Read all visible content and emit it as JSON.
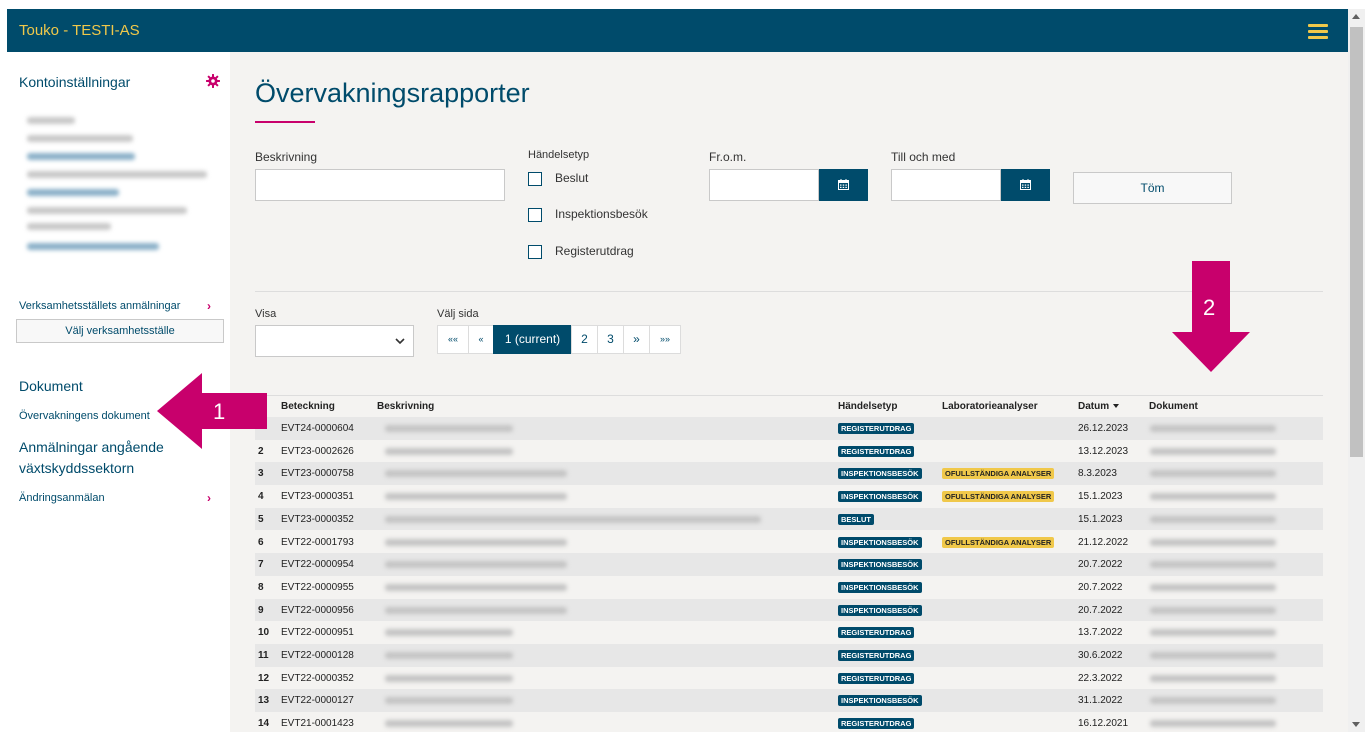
{
  "app": {
    "title": "Touko - TESTI-AS"
  },
  "colors": {
    "primary": "#004b6b",
    "accent": "#c8006c",
    "warning": "#f0c84a"
  },
  "sidebar": {
    "account_heading": "Kontoinställningar",
    "notifications_link": "Verksamhetsställets anmälningar",
    "select_site_button": "Välj verksamhetsställe",
    "documents_heading": "Dokument",
    "surveillance_docs_link": "Övervakningens dokument",
    "notifications_heading_line1": "Anmälningar angående",
    "notifications_heading_line2": "växtskyddssektorn",
    "change_notice_link": "Ändringsanmälan"
  },
  "main": {
    "title": "Övervakningsrapporter",
    "filters": {
      "description_label": "Beskrivning",
      "event_type_label": "Händelsetyp",
      "from_label": "Fr.o.m.",
      "to_label": "Till och med",
      "clear_button": "Töm",
      "checkboxes": [
        "Beslut",
        "Inspektionsbesök",
        "Registerutdrag"
      ]
    },
    "show_label": "Visa",
    "page_label": "Välj sida",
    "pagination": {
      "first": "««",
      "prev": "«",
      "current": "1 (current)",
      "page2": "2",
      "page3": "3",
      "next": "»",
      "last": "»»"
    },
    "table": {
      "headers": [
        "Beteckning",
        "Beskrivning",
        "Händelsetyp",
        "Laboratorieanalyser",
        "Datum",
        "Dokument"
      ],
      "rows": [
        {
          "num": "",
          "id": "EVT24-0000604",
          "type": "REGISTERUTDRAG",
          "lab": "",
          "date": "26.12.2023"
        },
        {
          "num": "2",
          "id": "EVT23-0002626",
          "type": "REGISTERUTDRAG",
          "lab": "",
          "date": "13.12.2023"
        },
        {
          "num": "3",
          "id": "EVT23-0000758",
          "type": "INSPEKTIONSBESÖK",
          "lab": "OFULLSTÄNDIGA ANALYSER",
          "date": "8.3.2023"
        },
        {
          "num": "4",
          "id": "EVT23-0000351",
          "type": "INSPEKTIONSBESÖK",
          "lab": "OFULLSTÄNDIGA ANALYSER",
          "date": "15.1.2023"
        },
        {
          "num": "5",
          "id": "EVT23-0000352",
          "type": "BESLUT",
          "lab": "",
          "date": "15.1.2023"
        },
        {
          "num": "6",
          "id": "EVT22-0001793",
          "type": "INSPEKTIONSBESÖK",
          "lab": "OFULLSTÄNDIGA ANALYSER",
          "date": "21.12.2022"
        },
        {
          "num": "7",
          "id": "EVT22-0000954",
          "type": "INSPEKTIONSBESÖK",
          "lab": "",
          "date": "20.7.2022"
        },
        {
          "num": "8",
          "id": "EVT22-0000955",
          "type": "INSPEKTIONSBESÖK",
          "lab": "",
          "date": "20.7.2022"
        },
        {
          "num": "9",
          "id": "EVT22-0000956",
          "type": "INSPEKTIONSBESÖK",
          "lab": "",
          "date": "20.7.2022"
        },
        {
          "num": "10",
          "id": "EVT22-0000951",
          "type": "REGISTERUTDRAG",
          "lab": "",
          "date": "13.7.2022"
        },
        {
          "num": "11",
          "id": "EVT22-0000128",
          "type": "REGISTERUTDRAG",
          "lab": "",
          "date": "30.6.2022"
        },
        {
          "num": "12",
          "id": "EVT22-0000352",
          "type": "REGISTERUTDRAG",
          "lab": "",
          "date": "22.3.2022"
        },
        {
          "num": "13",
          "id": "EVT22-0000127",
          "type": "INSPEKTIONSBESÖK",
          "lab": "",
          "date": "31.1.2022"
        },
        {
          "num": "14",
          "id": "EVT21-0001423",
          "type": "REGISTERUTDRAG",
          "lab": "",
          "date": "16.12.2021"
        }
      ]
    }
  },
  "annotations": {
    "marker1": "1",
    "marker2": "2"
  }
}
